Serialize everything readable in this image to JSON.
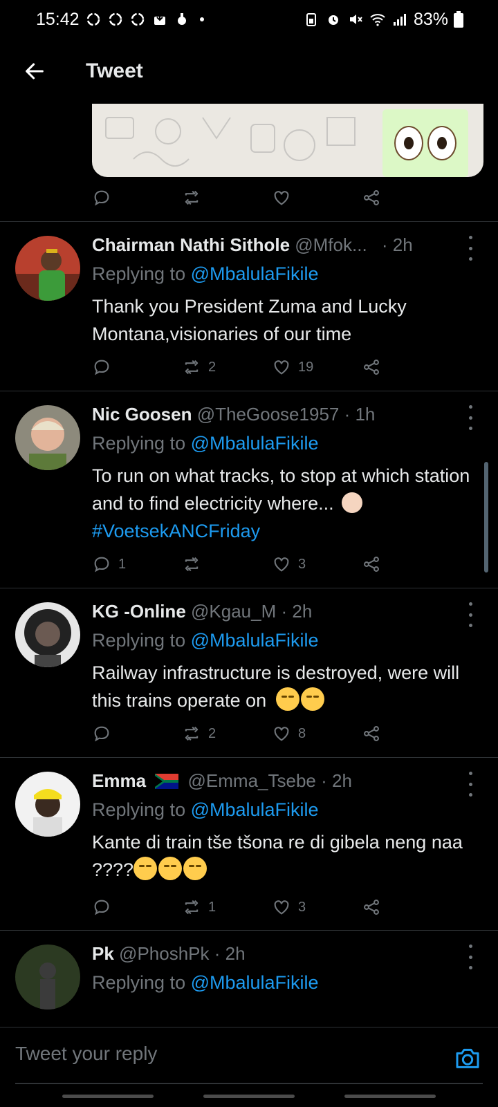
{
  "status": {
    "time": "15:42",
    "battery": "83%"
  },
  "header": {
    "title": "Tweet"
  },
  "top_media_actions": {
    "comments": "",
    "retweets": "",
    "likes": ""
  },
  "tweets": [
    {
      "name": "Chairman Nathi Sithole",
      "handle": "@Mfok...",
      "time": "· 2h",
      "replying_prefix": "Replying to ",
      "replying_to": "@MbalulaFikile",
      "text": "Thank you President Zuma and Lucky Montana,visionaries of our time",
      "comments": "",
      "retweets": "2",
      "likes": "19"
    },
    {
      "name": "Nic Goosen",
      "handle": "@TheGoose1957",
      "time": "· 1h",
      "replying_prefix": "Replying to ",
      "replying_to": "@MbalulaFikile",
      "text": "To run on what tracks, to stop at which station and to find electricity where...",
      "hashtag": "#VoetsekANCFriday",
      "comments": "1",
      "retweets": "",
      "likes": "3"
    },
    {
      "name": "KG -Online",
      "handle": "@Kgau_M",
      "time": "· 2h",
      "replying_prefix": "Replying to ",
      "replying_to": "@MbalulaFikile",
      "text": "Railway infrastructure is destroyed, were will this trains operate on",
      "comments": "",
      "retweets": "2",
      "likes": "8"
    },
    {
      "name": "Emma",
      "handle": "@Emma_Tsebe",
      "time": "· 2h",
      "replying_prefix": "Replying to ",
      "replying_to": "@MbalulaFikile",
      "text": "Kante di train tše tšona re di gibela neng naa ????",
      "comments": "",
      "retweets": "1",
      "likes": "3"
    },
    {
      "name": "Pk",
      "handle": "@PhoshPk",
      "time": "· 2h",
      "replying_prefix": "Replying to ",
      "replying_to": "@MbalulaFikile"
    }
  ],
  "compose": {
    "placeholder": "Tweet your reply"
  },
  "colors": {
    "accent": "#1d9bf0",
    "muted": "#71767b",
    "background": "#000000",
    "divider": "#2f3336"
  }
}
